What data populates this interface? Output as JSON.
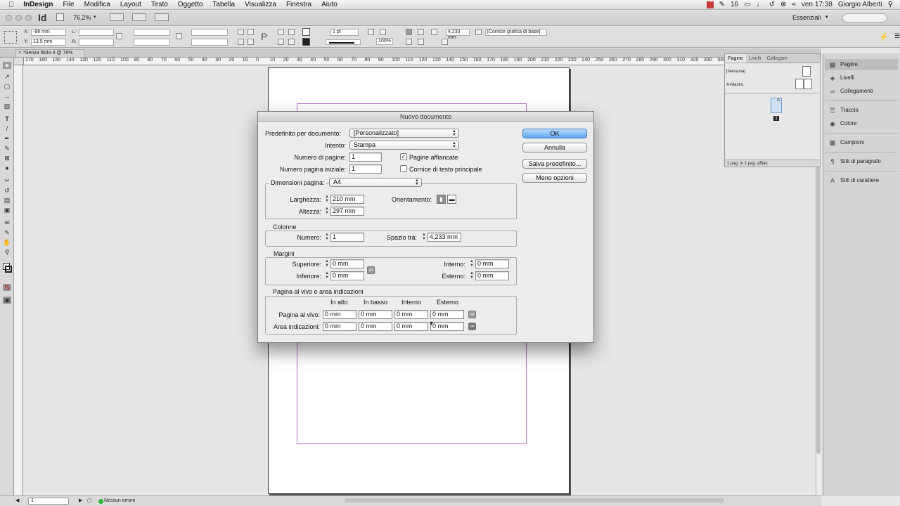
{
  "menubar": {
    "apple": "",
    "app": "InDesign",
    "items": [
      "File",
      "Modifica",
      "Layout",
      "Testo",
      "Oggetto",
      "Tabella",
      "Visualizza",
      "Finestra",
      "Aiuto"
    ],
    "right": {
      "count": "16",
      "clock": "ven 17:38",
      "user": "Giorgio Alberti"
    }
  },
  "app_header": {
    "logo": "Id",
    "zoom": "76,2%",
    "workspace": "Essenziali"
  },
  "control_bar": {
    "x_label": "X:",
    "x_value": "-88 mm",
    "y_label": "Y:",
    "y_value": "13,5 mm",
    "l_label": "L:",
    "a_label": "A:",
    "stroke_weight": "1 pt",
    "opacity": "100%",
    "gap_value": "4,233 mm",
    "object_style": "[Cornice grafica di base]"
  },
  "document_tab": {
    "title": "*Senza titolo-3 @ 76%"
  },
  "hruler_numbers": [
    "170",
    "160",
    "150",
    "140",
    "130",
    "120",
    "110",
    "100",
    "90",
    "80",
    "70",
    "60",
    "50",
    "40",
    "30",
    "20",
    "10",
    "0",
    "10",
    "20",
    "30",
    "40",
    "50",
    "60",
    "70",
    "80",
    "90",
    "100",
    "110",
    "120",
    "130",
    "140",
    "150",
    "160",
    "170",
    "180",
    "190",
    "200",
    "210",
    "220",
    "230",
    "240",
    "250",
    "260",
    "270",
    "280",
    "290",
    "300",
    "310",
    "320",
    "330",
    "340",
    "350",
    "360",
    "370",
    "380"
  ],
  "pages_panel": {
    "tabs": [
      "Pagine",
      "Livelli",
      "Collegam"
    ],
    "none_item": "[Nessuna]",
    "master_item": "A-Mastro",
    "page_number": "1",
    "master_letter": "A",
    "footer": "1 pag. in 1 pag. affian"
  },
  "dock": {
    "items": [
      "Pagine",
      "Livelli",
      "Collegamenti",
      "Traccia",
      "Colore",
      "Campioni",
      "Stili di paragrafo",
      "Stili di carattere"
    ]
  },
  "status_bar": {
    "page": "1",
    "errors": "Nessun errore"
  },
  "dialog": {
    "title": "Nuovo documento",
    "preset_label": "Predefinito per documento:",
    "preset_value": "[Personalizzato]",
    "intent_label": "Intento:",
    "intent_value": "Stampa",
    "pages_label": "Numero di pagine:",
    "pages_value": "1",
    "facing_label": "Pagine affiancate",
    "facing_checked": true,
    "start_label": "Numero pagina iniziale:",
    "start_value": "1",
    "primary_frame_label": "Cornice di testo principale",
    "primary_frame_checked": false,
    "size_label": "Dimensioni pagina:",
    "size_value": "A4",
    "width_label": "Larghezza:",
    "width_value": "210 mm",
    "height_label": "Altezza:",
    "height_value": "297 mm",
    "orientation_label": "Orientamento:",
    "columns_group": "Colonne",
    "columns_number_label": "Numero:",
    "columns_number_value": "1",
    "gutter_label": "Spazio tra:",
    "gutter_value": "4,233 mm",
    "margins_group": "Margini",
    "top_label": "Superiore:",
    "top_value": "0 mm",
    "bottom_label": "Inferiore:",
    "bottom_value": "0 mm",
    "inside_label": "Interno:",
    "inside_value": "0 mm",
    "outside_label": "Esterno:",
    "outside_value": "0 mm",
    "bleed_group": "Pagina al vivo e area indicazioni",
    "col_top": "In alto",
    "col_bottom": "In basso",
    "col_inside": "Interno",
    "col_outside": "Esterno",
    "bleed_label": "Pagina al vivo:",
    "bleed_values": [
      "0 mm",
      "0 mm",
      "0 mm",
      "0 mm"
    ],
    "slug_label": "Area indicazioni:",
    "slug_values": [
      "0 mm",
      "0 mm",
      "0 mm",
      "0 mm"
    ],
    "ok": "OK",
    "cancel": "Annulla",
    "save_preset": "Salva predefinito...",
    "fewer_options": "Meno opzioni"
  }
}
